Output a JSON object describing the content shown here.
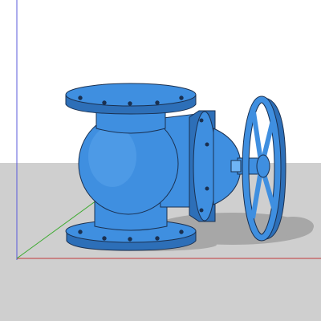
{
  "viewport": {
    "sky_color": "#ffffff",
    "ground_color": "#cfcfcf"
  },
  "axes": {
    "red_axis_color": "#c0393b",
    "green_axis_color": "#3caa2f",
    "blue_axis_color": "#5a5adb"
  },
  "model": {
    "body_color": "#3f8fe0",
    "body_dark_color": "#2d6fb8",
    "body_light_color": "#6fb4f5",
    "edge_color": "#1a3050",
    "shadow_color": "#a7a7a7",
    "icon": "valve-model"
  }
}
